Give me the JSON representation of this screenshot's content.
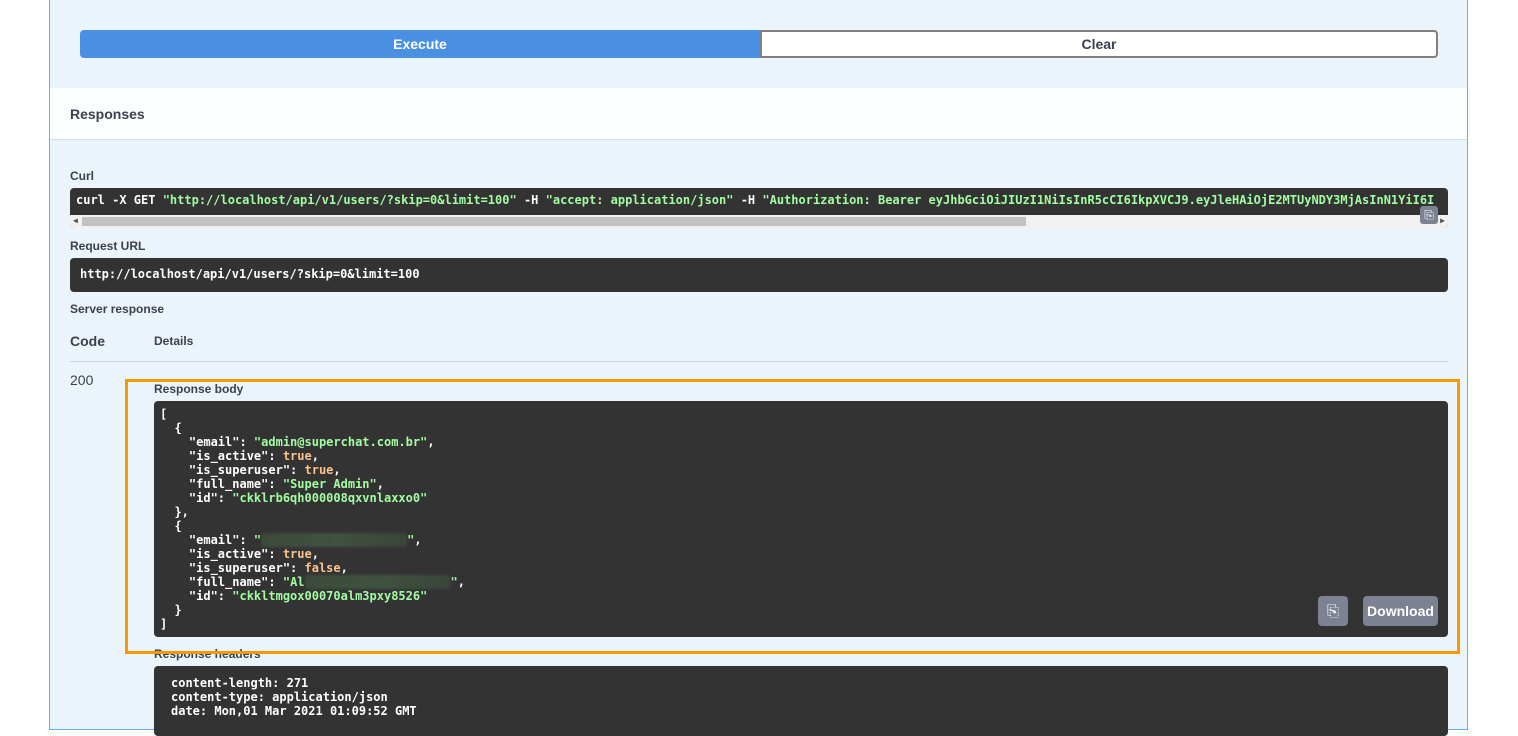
{
  "buttons": {
    "execute": "Execute",
    "clear": "Clear"
  },
  "responses_title": "Responses",
  "curl": {
    "label": "Curl",
    "parts": {
      "cmd": "curl -X GET ",
      "url": "\"http://localhost/api/v1/users/?skip=0&limit=100\"",
      "h1": " -H ",
      "accept": " \"accept: application/json\"",
      "h2": " -H ",
      "auth": " \"Authorization: Bearer eyJhbGciOiJIUzI1NiIsInR5cCI6IkpXVCJ9.eyJleHAiOjE2MTUyNDY3MjAsInN1YiI6I"
    }
  },
  "request_url": {
    "label": "Request URL",
    "value": "http://localhost/api/v1/users/?skip=0&limit=100"
  },
  "server_response": {
    "label": "Server response",
    "col_code": "Code",
    "col_details": "Details",
    "code": "200",
    "response_body_label": "Response body",
    "response_headers_label": "Response headers",
    "download_label": "Download"
  },
  "users": [
    {
      "email": "admin@superchat.com.br",
      "is_active": "true",
      "is_superuser": "true",
      "full_name": "Super Admin",
      "id": "ckklrb6qh000008qxvnlaxxo0"
    },
    {
      "email": "",
      "is_active": "true",
      "is_superuser": "false",
      "full_name": "Al",
      "id": "ckkltmgox00070alm3pxy8526"
    }
  ],
  "response_headers": [
    "content-length: 271",
    "content-type: application/json",
    "date: Mon,01 Mar 2021 01:09:52 GMT"
  ],
  "colors": {
    "execute": "#4990e2",
    "highlight": "#f79a00",
    "code_bg": "#333333",
    "string": "#a2fca2",
    "literal": "#fcc28c"
  }
}
